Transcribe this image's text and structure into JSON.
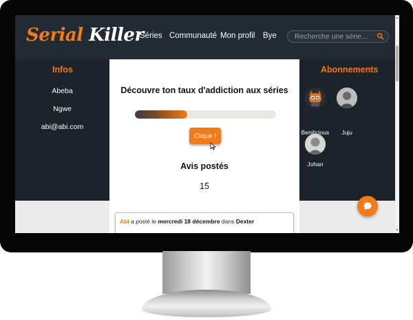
{
  "site": {
    "logo_part1": "Serial ",
    "logo_part2": "Killer",
    "nav": [
      "Séries",
      "Communauté",
      "Mon profil",
      "Bye"
    ],
    "search_placeholder": "Recherche une série..."
  },
  "infos": {
    "title": "Infos",
    "first_name": "Abeba",
    "last_name": "Ngwe",
    "email": "abi@abi.com"
  },
  "addiction": {
    "heading": "Découvre ton taux d'addiction aux séries",
    "level_fraction": 0.37,
    "button_label": "Clique !"
  },
  "reviews": {
    "heading": "Avis postés",
    "count": "15"
  },
  "post": {
    "user": "Abi",
    "text1": " a posté le ",
    "date": "mercredi 18 décembre",
    "text2": " dans ",
    "series": "Dexter"
  },
  "subscriptions": {
    "title": "Abonnements",
    "users": [
      "Benilicious",
      "Juju",
      "Johan"
    ]
  },
  "colors": {
    "accent": "#f17a19",
    "dark": "#1c232b",
    "header": "#222a33"
  }
}
